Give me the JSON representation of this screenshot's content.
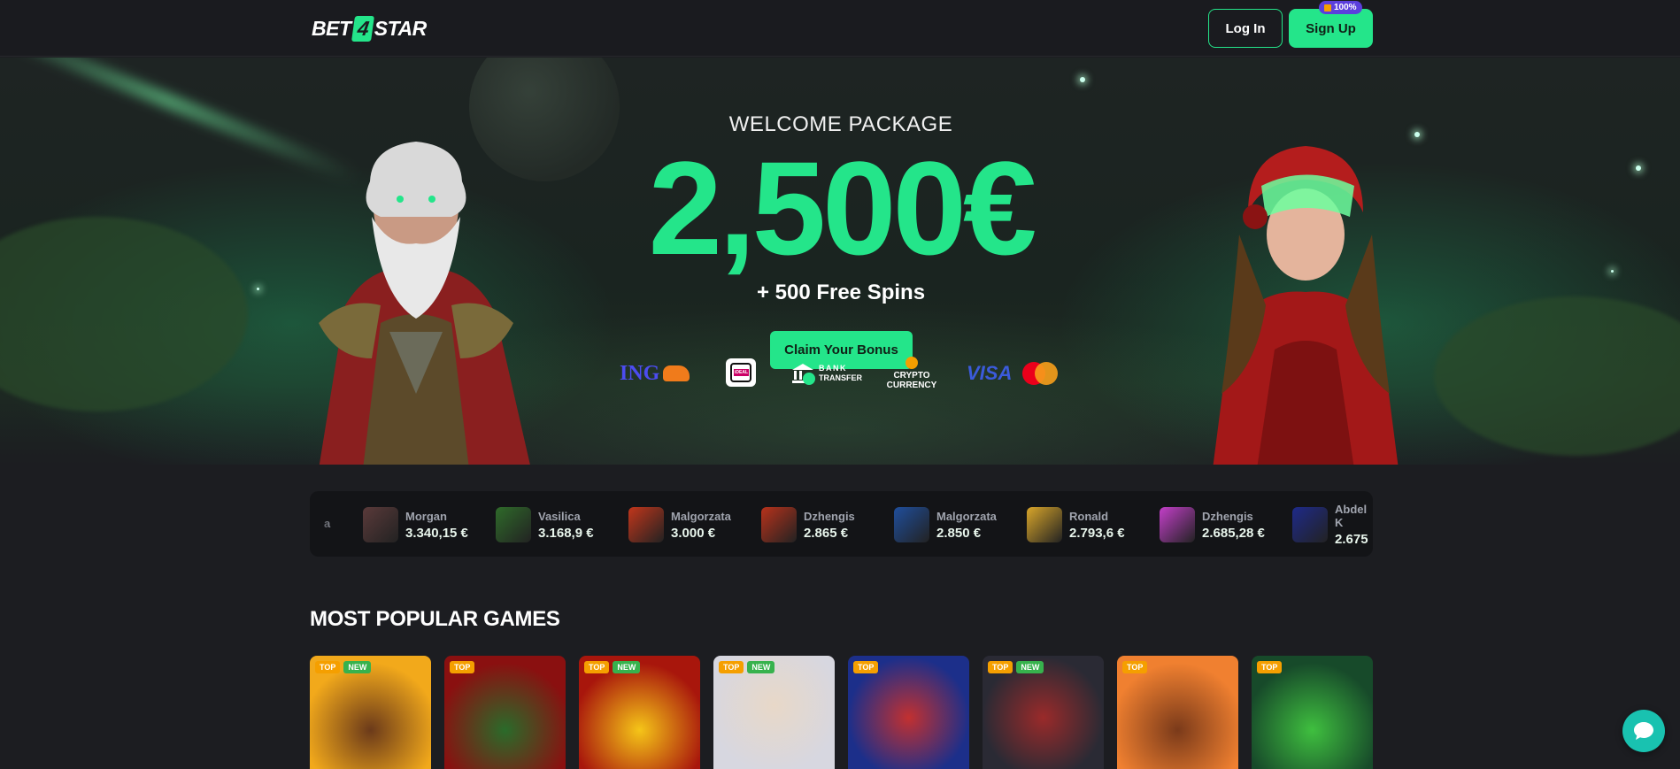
{
  "brand": {
    "prefix": "BET",
    "box": "4",
    "suffix": "STAR"
  },
  "header": {
    "login_label": "Log In",
    "signup_label": "Sign Up",
    "signup_badge": "100%"
  },
  "hero": {
    "title": "WELCOME PACKAGE",
    "amount": "2,500€",
    "subtitle": "+ 500 Free Spins",
    "cta_label": "Claim Your Bonus"
  },
  "payments": {
    "ing": "ING",
    "ideal": "iDEAL",
    "bank_line1": "BANK",
    "bank_line2": "TRANSFER",
    "crypto_line1": "CRYPTO",
    "crypto_line2": "CURRENCY",
    "visa": "VISA"
  },
  "winners": [
    {
      "name": "a",
      "amount": "",
      "icon": "game-thumb"
    },
    {
      "name": "Morgan",
      "amount": "3.340,15 €",
      "icon": "most-wanted-thumb"
    },
    {
      "name": "Vasilica",
      "amount": "3.168,9 €",
      "icon": "lucky-clover-thumb"
    },
    {
      "name": "Malgorzata",
      "amount": "3.000 €",
      "icon": "hot-slot-thumb"
    },
    {
      "name": "Dzhengis",
      "amount": "2.865 €",
      "icon": "hot-slot-thumb"
    },
    {
      "name": "Malgorzata",
      "amount": "2.850 €",
      "icon": "chests-thumb"
    },
    {
      "name": "Ronald",
      "amount": "2.793,6 €",
      "icon": "aztec-thumb"
    },
    {
      "name": "Dzhengis",
      "amount": "2.685,28 €",
      "icon": "trillion-thumb"
    },
    {
      "name": "Abdel K",
      "amount": "2.675",
      "icon": "atomic-coins-thumb"
    }
  ],
  "section": {
    "title": "MOST POPULAR GAMES"
  },
  "games": [
    {
      "tags": [
        "TOP",
        "NEW"
      ],
      "icon": "bison-game-thumb"
    },
    {
      "tags": [
        "TOP"
      ],
      "icon": "watermelon-game-thumb"
    },
    {
      "tags": [
        "TOP",
        "NEW"
      ],
      "icon": "chicken-coin-game-thumb"
    },
    {
      "tags": [
        "TOP",
        "NEW"
      ],
      "icon": "gentleman-game-thumb"
    },
    {
      "tags": [
        "TOP"
      ],
      "icon": "witch-game-thumb"
    },
    {
      "tags": [
        "TOP",
        "NEW"
      ],
      "icon": "joker-game-thumb"
    },
    {
      "tags": [
        "TOP"
      ],
      "icon": "buffalo-game-thumb"
    },
    {
      "tags": [
        "TOP"
      ],
      "icon": "frog-game-thumb"
    }
  ],
  "colors": {
    "accent": "#24e58a",
    "background": "#1c1d21",
    "header": "#1a1b1f",
    "chat": "#19c2b0"
  }
}
